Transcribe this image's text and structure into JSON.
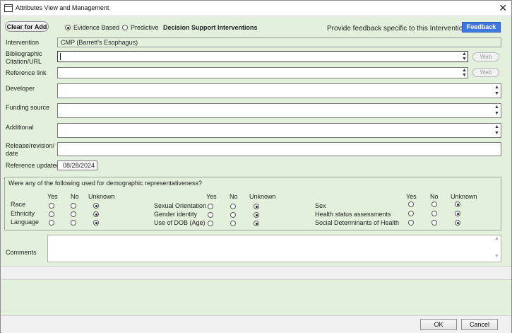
{
  "window": {
    "title": "Attributes View and Management",
    "close_glyph": "✕"
  },
  "toolbar": {
    "clear_label": "Clear for Add",
    "radio_evidence": "Evidence Based",
    "radio_predictive": "Predictive",
    "section_label": "Decision Support Interventions",
    "feedback_prompt": "Provide feedback specific to this Intervention",
    "feedback_label": "Feedback",
    "selected_type": "Evidence Based"
  },
  "form": {
    "intervention_label": "Intervention",
    "intervention_value": "CMP (Barrett's Esophagus)",
    "citation_label_1": "Bibliographic",
    "citation_label_2": "Citation/URL",
    "citation_value": "",
    "reference_link_label": "Reference link",
    "reference_link_value": "",
    "web_label": "Web",
    "developer_label": "Developer",
    "developer_value": "",
    "funding_label": "Funding source",
    "funding_value": "",
    "additional_label": "Additional",
    "additional_value": "",
    "release_label_1": "Release/revision/",
    "release_label_2": "date",
    "release_value": "",
    "reference_updated_label": "Reference updated",
    "reference_updated_value": "08/28/2024",
    "comments_label": "Comments",
    "comments_value": ""
  },
  "demographics": {
    "question": "Were any of the following used for demographic representativeness?",
    "headers": [
      "Yes",
      "No",
      "Unknown"
    ],
    "groups": [
      {
        "rows": [
          {
            "label": "Race",
            "selected": "Unknown"
          },
          {
            "label": "Ethnicity",
            "selected": "Unknown"
          },
          {
            "label": "Language",
            "selected": "Unknown"
          }
        ]
      },
      {
        "rows": [
          {
            "label": "Sexual Orientation",
            "selected": "Unknown"
          },
          {
            "label": "Gender identity",
            "selected": "Unknown"
          },
          {
            "label": "Use of DOB (Age)",
            "selected": "Unknown"
          }
        ]
      },
      {
        "rows": [
          {
            "label": "Sex",
            "selected": "Unknown"
          },
          {
            "label": "Health status assessments",
            "selected": "Unknown"
          },
          {
            "label": "Social Determinants of Health",
            "selected": "Unknown"
          }
        ]
      }
    ]
  },
  "footer": {
    "ok_label": "OK",
    "cancel_label": "Cancel"
  },
  "colors": {
    "panel": "#e2f0dc",
    "feedback_button": "#3e78e0"
  }
}
